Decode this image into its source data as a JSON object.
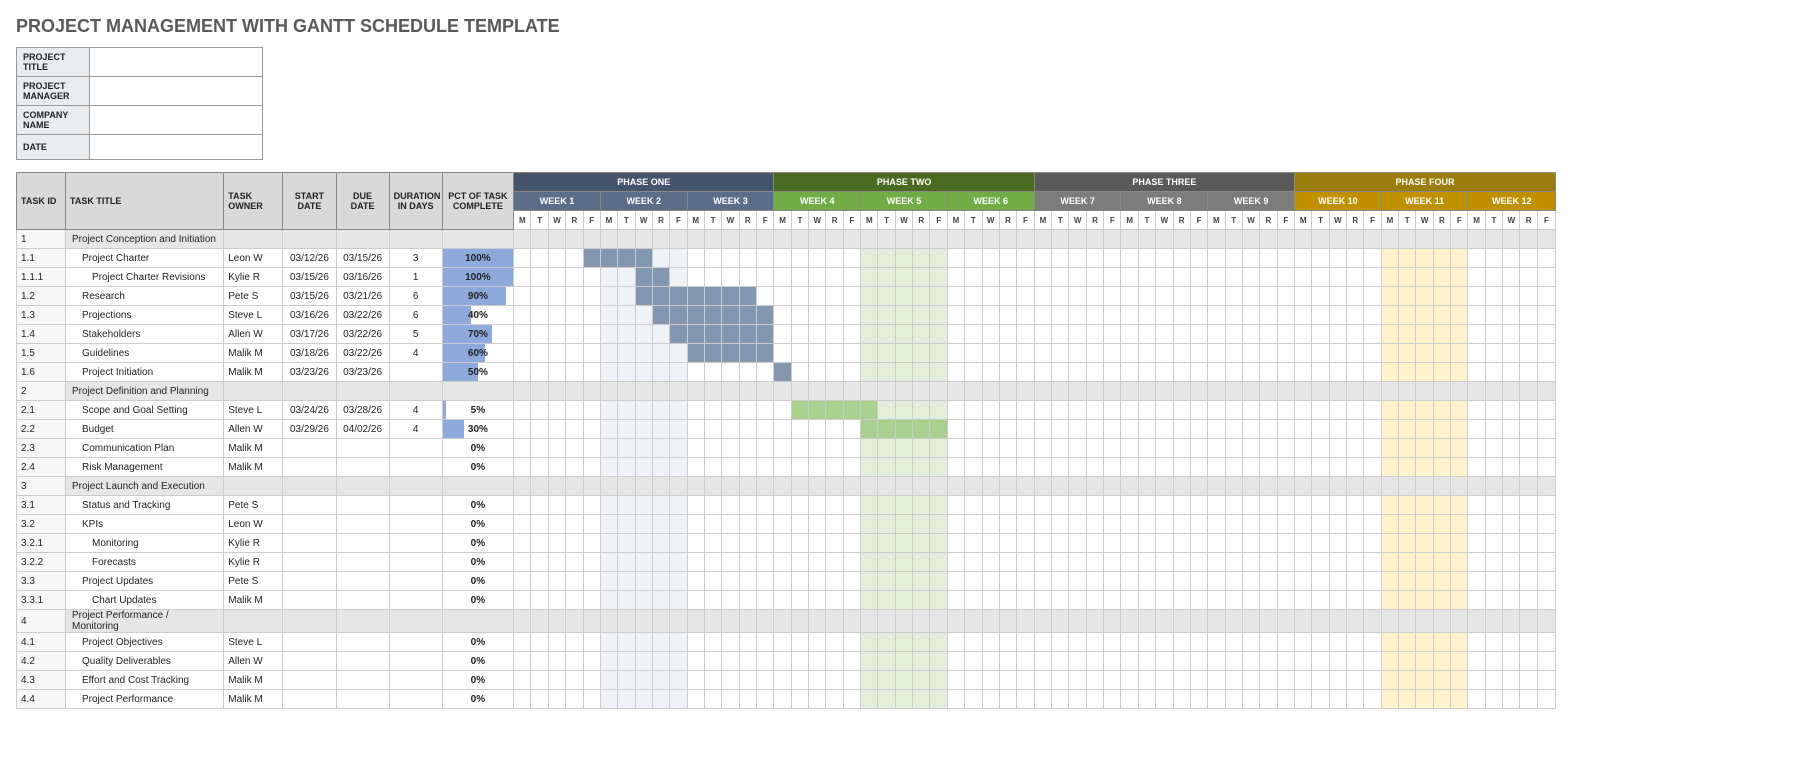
{
  "title": "PROJECT MANAGEMENT WITH GANTT SCHEDULE TEMPLATE",
  "meta_labels": {
    "project_title": "PROJECT TITLE",
    "project_manager": "PROJECT MANAGER",
    "company_name": "COMPANY NAME",
    "date": "DATE"
  },
  "meta_values": {
    "project_title": "",
    "project_manager": "",
    "company_name": "",
    "date": ""
  },
  "columns": {
    "id": "TASK ID",
    "title": "TASK TITLE",
    "owner": "TASK OWNER",
    "start": "START DATE",
    "due": "DUE DATE",
    "duration": "DURATION IN DAYS",
    "pct": "PCT OF TASK COMPLETE"
  },
  "phases": [
    {
      "label": "PHASE ONE",
      "bg": "#44546a",
      "weeks": [
        {
          "label": "WEEK 1",
          "bg": "#5b6d88"
        },
        {
          "label": "WEEK 2",
          "bg": "#5b6d88"
        },
        {
          "label": "WEEK 3",
          "bg": "#5b6d88"
        }
      ],
      "tint": "p1t"
    },
    {
      "label": "PHASE TWO",
      "bg": "#4a6b1f",
      "weeks": [
        {
          "label": "WEEK 4",
          "bg": "#70ad47"
        },
        {
          "label": "WEEK 5",
          "bg": "#70ad47"
        },
        {
          "label": "WEEK 6",
          "bg": "#70ad47"
        }
      ],
      "tint": "p2t"
    },
    {
      "label": "PHASE THREE",
      "bg": "#595959",
      "weeks": [
        {
          "label": "WEEK 7",
          "bg": "#7c7c7c"
        },
        {
          "label": "WEEK 8",
          "bg": "#7c7c7c"
        },
        {
          "label": "WEEK 9",
          "bg": "#7c7c7c"
        }
      ],
      "tint": "p3t"
    },
    {
      "label": "PHASE FOUR",
      "bg": "#9a7d0a",
      "weeks": [
        {
          "label": "WEEK 10",
          "bg": "#bf9000"
        },
        {
          "label": "WEEK 11",
          "bg": "#bf9000"
        },
        {
          "label": "WEEK 12",
          "bg": "#bf9000"
        }
      ],
      "tint": "p4t"
    }
  ],
  "days": [
    "M",
    "T",
    "W",
    "R",
    "F"
  ],
  "day_tints": [
    2,
    2,
    2,
    2,
    2,
    2,
    2,
    2,
    2,
    2,
    2,
    2,
    2,
    2,
    2,
    3,
    3,
    3,
    3,
    3,
    3,
    3,
    3,
    3,
    3,
    3,
    3,
    3,
    3,
    3,
    1,
    1,
    1,
    1,
    1,
    1,
    1,
    1,
    1,
    1,
    1,
    1,
    1,
    1,
    1,
    4,
    4,
    4,
    4,
    4,
    4,
    4,
    4,
    4,
    4,
    4,
    4,
    4,
    4,
    4
  ],
  "tasks": [
    {
      "id": "1",
      "title": "Project Conception and Initiation",
      "section": true
    },
    {
      "id": "1.1",
      "title": "Project Charter",
      "ind": 1,
      "owner": "Leon W",
      "start": "03/12/26",
      "due": "03/15/26",
      "dur": "3",
      "pct": 100,
      "bar": {
        "start": 5,
        "len": 4,
        "cls": "bar1"
      }
    },
    {
      "id": "1.1.1",
      "title": "Project Charter Revisions",
      "ind": 2,
      "owner": "Kylie R",
      "start": "03/15/26",
      "due": "03/16/26",
      "dur": "1",
      "pct": 100,
      "bar": {
        "start": 8,
        "len": 2,
        "cls": "bar1"
      }
    },
    {
      "id": "1.2",
      "title": "Research",
      "ind": 1,
      "owner": "Pete S",
      "start": "03/15/26",
      "due": "03/21/26",
      "dur": "6",
      "pct": 90,
      "bar": {
        "start": 8,
        "len": 7,
        "cls": "bar1"
      }
    },
    {
      "id": "1.3",
      "title": "Projections",
      "ind": 1,
      "owner": "Steve L",
      "start": "03/16/26",
      "due": "03/22/26",
      "dur": "6",
      "pct": 40,
      "bar": {
        "start": 9,
        "len": 7,
        "cls": "bar1"
      }
    },
    {
      "id": "1.4",
      "title": "Stakeholders",
      "ind": 1,
      "owner": "Allen W",
      "start": "03/17/26",
      "due": "03/22/26",
      "dur": "5",
      "pct": 70,
      "bar": {
        "start": 10,
        "len": 6,
        "cls": "bar1"
      }
    },
    {
      "id": "1.5",
      "title": "Guidelines",
      "ind": 1,
      "owner": "Malik M",
      "start": "03/18/26",
      "due": "03/22/26",
      "dur": "4",
      "pct": 60,
      "bar": {
        "start": 11,
        "len": 5,
        "cls": "bar1"
      }
    },
    {
      "id": "1.6",
      "title": "Project Initiation",
      "ind": 1,
      "owner": "Malik M",
      "start": "03/23/26",
      "due": "03/23/26",
      "dur": "",
      "pct": 50,
      "bar": {
        "start": 16,
        "len": 1,
        "cls": "bar1"
      }
    },
    {
      "id": "2",
      "title": "Project Definition and Planning",
      "section": true
    },
    {
      "id": "2.1",
      "title": "Scope and Goal Setting",
      "ind": 1,
      "owner": "Steve L",
      "start": "03/24/26",
      "due": "03/28/26",
      "dur": "4",
      "pct": 5,
      "bar": {
        "start": 17,
        "len": 5,
        "cls": "bar2"
      }
    },
    {
      "id": "2.2",
      "title": "Budget",
      "ind": 1,
      "owner": "Allen W",
      "start": "03/29/26",
      "due": "04/02/26",
      "dur": "4",
      "pct": 30,
      "bar": {
        "start": 21,
        "len": 5,
        "cls": "bar2"
      }
    },
    {
      "id": "2.3",
      "title": "Communication Plan",
      "ind": 1,
      "owner": "Malik M",
      "start": "",
      "due": "",
      "dur": "",
      "pct": 0
    },
    {
      "id": "2.4",
      "title": "Risk Management",
      "ind": 1,
      "owner": "Malik M",
      "start": "",
      "due": "",
      "dur": "",
      "pct": 0
    },
    {
      "id": "3",
      "title": "Project Launch and Execution",
      "section": true
    },
    {
      "id": "3.1",
      "title": "Status and Tracking",
      "ind": 1,
      "owner": "Pete S",
      "start": "",
      "due": "",
      "dur": "",
      "pct": 0
    },
    {
      "id": "3.2",
      "title": "KPIs",
      "ind": 1,
      "owner": "Leon W",
      "start": "",
      "due": "",
      "dur": "",
      "pct": 0
    },
    {
      "id": "3.2.1",
      "title": "Monitoring",
      "ind": 2,
      "owner": "Kylie R",
      "start": "",
      "due": "",
      "dur": "",
      "pct": 0
    },
    {
      "id": "3.2.2",
      "title": "Forecasts",
      "ind": 2,
      "owner": "Kylie R",
      "start": "",
      "due": "",
      "dur": "",
      "pct": 0
    },
    {
      "id": "3.3",
      "title": "Project Updates",
      "ind": 1,
      "owner": "Pete S",
      "start": "",
      "due": "",
      "dur": "",
      "pct": 0
    },
    {
      "id": "3.3.1",
      "title": "Chart Updates",
      "ind": 2,
      "owner": "Malik M",
      "start": "",
      "due": "",
      "dur": "",
      "pct": 0
    },
    {
      "id": "4",
      "title": "Project Performance / Monitoring",
      "section": true
    },
    {
      "id": "4.1",
      "title": "Project Objectives",
      "ind": 1,
      "owner": "Steve L",
      "start": "",
      "due": "",
      "dur": "",
      "pct": 0
    },
    {
      "id": "4.2",
      "title": "Quality Deliverables",
      "ind": 1,
      "owner": "Allen W",
      "start": "",
      "due": "",
      "dur": "",
      "pct": 0
    },
    {
      "id": "4.3",
      "title": "Effort and Cost Tracking",
      "ind": 1,
      "owner": "Malik M",
      "start": "",
      "due": "",
      "dur": "",
      "pct": 0
    },
    {
      "id": "4.4",
      "title": "Project Performance",
      "ind": 1,
      "owner": "Malik M",
      "start": "",
      "due": "",
      "dur": "",
      "pct": 0
    }
  ],
  "chart_data": {
    "type": "gantt",
    "title": "PROJECT MANAGEMENT WITH GANTT SCHEDULE TEMPLATE",
    "xlabel": "Weeks 1–12 (M T W R F)",
    "phases": [
      "PHASE ONE",
      "PHASE TWO",
      "PHASE THREE",
      "PHASE FOUR"
    ],
    "weeks_per_phase": 3,
    "days_per_week": 5,
    "tasks": [
      {
        "id": "1.1",
        "name": "Project Charter",
        "owner": "Leon W",
        "start": "03/12/26",
        "end": "03/15/26",
        "duration_days": 3,
        "pct_complete": 100
      },
      {
        "id": "1.1.1",
        "name": "Project Charter Revisions",
        "owner": "Kylie R",
        "start": "03/15/26",
        "end": "03/16/26",
        "duration_days": 1,
        "pct_complete": 100
      },
      {
        "id": "1.2",
        "name": "Research",
        "owner": "Pete S",
        "start": "03/15/26",
        "end": "03/21/26",
        "duration_days": 6,
        "pct_complete": 90
      },
      {
        "id": "1.3",
        "name": "Projections",
        "owner": "Steve L",
        "start": "03/16/26",
        "end": "03/22/26",
        "duration_days": 6,
        "pct_complete": 40
      },
      {
        "id": "1.4",
        "name": "Stakeholders",
        "owner": "Allen W",
        "start": "03/17/26",
        "end": "03/22/26",
        "duration_days": 5,
        "pct_complete": 70
      },
      {
        "id": "1.5",
        "name": "Guidelines",
        "owner": "Malik M",
        "start": "03/18/26",
        "end": "03/22/26",
        "duration_days": 4,
        "pct_complete": 60
      },
      {
        "id": "1.6",
        "name": "Project Initiation",
        "owner": "Malik M",
        "start": "03/23/26",
        "end": "03/23/26",
        "duration_days": 0,
        "pct_complete": 50
      },
      {
        "id": "2.1",
        "name": "Scope and Goal Setting",
        "owner": "Steve L",
        "start": "03/24/26",
        "end": "03/28/26",
        "duration_days": 4,
        "pct_complete": 5
      },
      {
        "id": "2.2",
        "name": "Budget",
        "owner": "Allen W",
        "start": "03/29/26",
        "end": "04/02/26",
        "duration_days": 4,
        "pct_complete": 30
      },
      {
        "id": "2.3",
        "name": "Communication Plan",
        "owner": "Malik M",
        "pct_complete": 0
      },
      {
        "id": "2.4",
        "name": "Risk Management",
        "owner": "Malik M",
        "pct_complete": 0
      },
      {
        "id": "3.1",
        "name": "Status and Tracking",
        "owner": "Pete S",
        "pct_complete": 0
      },
      {
        "id": "3.2",
        "name": "KPIs",
        "owner": "Leon W",
        "pct_complete": 0
      },
      {
        "id": "3.2.1",
        "name": "Monitoring",
        "owner": "Kylie R",
        "pct_complete": 0
      },
      {
        "id": "3.2.2",
        "name": "Forecasts",
        "owner": "Kylie R",
        "pct_complete": 0
      },
      {
        "id": "3.3",
        "name": "Project Updates",
        "owner": "Pete S",
        "pct_complete": 0
      },
      {
        "id": "3.3.1",
        "name": "Chart Updates",
        "owner": "Malik M",
        "pct_complete": 0
      },
      {
        "id": "4.1",
        "name": "Project Objectives",
        "owner": "Steve L",
        "pct_complete": 0
      },
      {
        "id": "4.2",
        "name": "Quality Deliverables",
        "owner": "Allen W",
        "pct_complete": 0
      },
      {
        "id": "4.3",
        "name": "Effort and Cost Tracking",
        "owner": "Malik M",
        "pct_complete": 0
      },
      {
        "id": "4.4",
        "name": "Project Performance",
        "owner": "Malik M",
        "pct_complete": 0
      }
    ]
  }
}
